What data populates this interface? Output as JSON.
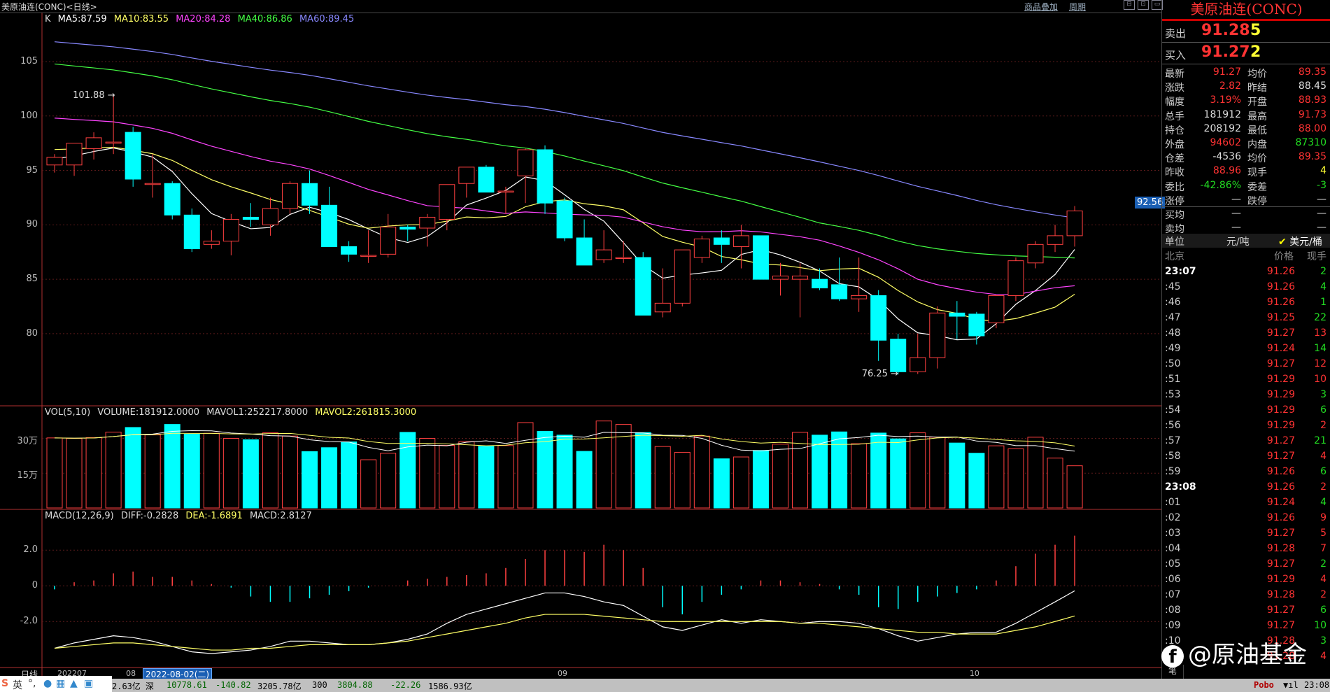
{
  "window": {
    "title": "美原油连(CONC)<日线>",
    "links": [
      "商品叠加",
      "周期"
    ]
  },
  "main_legend": {
    "k": "K",
    "ma": [
      {
        "label": "MA5:87.59",
        "color": "#ffffff"
      },
      {
        "label": "MA10:83.55",
        "color": "#ffff66"
      },
      {
        "label": "MA20:84.28",
        "color": "#ff44ff"
      },
      {
        "label": "MA40:86.86",
        "color": "#44ff44"
      },
      {
        "label": "MA60:89.45",
        "color": "#8888ff"
      }
    ]
  },
  "vol_legend": {
    "name": "VOL(5,10)",
    "volume": "VOLUME:181912.0000",
    "mavol1": "MAVOL1:252217.8000",
    "mavol2": "MAVOL2:261815.3000"
  },
  "macd_legend": {
    "name": "MACD(12,26,9)",
    "diff": "DIFF:-0.2828",
    "dea": "DEA:-1.6891",
    "macd": "MACD:2.8127"
  },
  "axes": {
    "price_ticks": [
      "105",
      "100",
      "95",
      "90",
      "85",
      "80"
    ],
    "vol_ticks": [
      "30万",
      "15万"
    ],
    "macd_ticks": [
      "2.0",
      "0",
      "-2.0"
    ],
    "date_labels": [
      "202207",
      "08",
      "09",
      "10"
    ],
    "cursor_date": "2022-08-02(二)",
    "period_tab": "日线"
  },
  "annotations": {
    "high": "101.88",
    "low": "76.25",
    "current_price_tag": "92.56"
  },
  "chart_data": {
    "type": "candlestick",
    "ohlc": [
      [
        95.5,
        96.5,
        94.8,
        96.2
      ],
      [
        95.5,
        97.5,
        94.5,
        97.5
      ],
      [
        97.0,
        98.5,
        96.0,
        98.0
      ],
      [
        97.5,
        101.88,
        96.5,
        97.6
      ],
      [
        98.5,
        99.0,
        93.5,
        94.2
      ],
      [
        93.8,
        96.5,
        92.5,
        93.8
      ],
      [
        93.8,
        94.0,
        90.5,
        90.9
      ],
      [
        90.9,
        91.5,
        87.5,
        87.8
      ],
      [
        88.2,
        89.5,
        87.8,
        88.5
      ],
      [
        88.5,
        91.0,
        87.2,
        90.5
      ],
      [
        90.7,
        92.0,
        89.8,
        90.5
      ],
      [
        90.0,
        92.5,
        89.0,
        91.5
      ],
      [
        91.5,
        94.0,
        91.0,
        93.8
      ],
      [
        93.8,
        95.0,
        91.0,
        91.8
      ],
      [
        91.8,
        93.5,
        88.0,
        88.0
      ],
      [
        88.0,
        88.5,
        86.6,
        87.3
      ],
      [
        87.2,
        89.5,
        86.5,
        87.2
      ],
      [
        87.3,
        91.0,
        87.0,
        89.8
      ],
      [
        89.8,
        90.0,
        88.5,
        89.6
      ],
      [
        89.7,
        91.0,
        88.0,
        90.7
      ],
      [
        90.5,
        93.5,
        89.5,
        93.7
      ],
      [
        93.8,
        95.0,
        92.5,
        95.3
      ],
      [
        95.3,
        95.5,
        93.0,
        93.0
      ],
      [
        93.0,
        93.5,
        91.0,
        93.1
      ],
      [
        94.5,
        97.0,
        92.0,
        96.9
      ],
      [
        96.9,
        97.3,
        91.0,
        92.0
      ],
      [
        92.2,
        92.5,
        88.5,
        88.8
      ],
      [
        88.8,
        90.5,
        86.3,
        86.3
      ],
      [
        86.8,
        89.5,
        86.5,
        87.7
      ],
      [
        87.0,
        88.5,
        86.5,
        87.0
      ],
      [
        87.0,
        87.5,
        81.8,
        81.7
      ],
      [
        82.0,
        86.0,
        81.5,
        82.8
      ],
      [
        82.8,
        87.0,
        82.5,
        87.7
      ],
      [
        87.0,
        89.0,
        86.5,
        88.7
      ],
      [
        88.8,
        89.5,
        86.5,
        88.2
      ],
      [
        88.0,
        90.0,
        86.0,
        89.0
      ],
      [
        89.0,
        89.0,
        85.0,
        85.0
      ],
      [
        85.0,
        86.5,
        83.5,
        85.3
      ],
      [
        85.0,
        86.5,
        81.5,
        85.3
      ],
      [
        85.0,
        86.0,
        84.0,
        84.2
      ],
      [
        84.5,
        87.0,
        83.0,
        83.2
      ],
      [
        83.2,
        87.0,
        82.0,
        83.5
      ],
      [
        83.5,
        84.0,
        77.5,
        79.4
      ],
      [
        79.5,
        80.0,
        76.25,
        76.5
      ],
      [
        76.5,
        80.0,
        76.3,
        77.8
      ],
      [
        77.8,
        82.5,
        76.8,
        81.9
      ],
      [
        81.9,
        83.0,
        79.5,
        81.6
      ],
      [
        81.8,
        82.0,
        79.0,
        79.8
      ],
      [
        81.0,
        83.5,
        80.5,
        83.5
      ],
      [
        83.5,
        87.0,
        83.0,
        86.7
      ],
      [
        86.5,
        88.5,
        86.0,
        88.2
      ],
      [
        88.2,
        90.0,
        87.5,
        89.0
      ],
      [
        89.0,
        91.73,
        88.0,
        91.28
      ]
    ],
    "volume": [
      302000,
      300000,
      303000,
      327000,
      347000,
      315000,
      360000,
      318000,
      322000,
      300000,
      294000,
      324000,
      310000,
      243000,
      260000,
      285000,
      208000,
      236000,
      326000,
      300000,
      270000,
      286000,
      266000,
      269000,
      368000,
      330000,
      314000,
      244000,
      375000,
      360000,
      325000,
      265000,
      240000,
      310000,
      212000,
      220000,
      248000,
      275000,
      326000,
      314000,
      328000,
      277000,
      323000,
      298000,
      324000,
      305000,
      280000,
      236000,
      268000,
      255000,
      305000,
      215000,
      181912
    ],
    "volume_ylim": [
      0,
      380000
    ],
    "price_ylim": [
      73.5,
      109.5
    ],
    "macd_hist": [
      -0.2,
      0.2,
      0.3,
      0.7,
      0.8,
      0.5,
      0.5,
      0.3,
      0.1,
      -0.1,
      -0.6,
      -0.9,
      -0.9,
      -0.7,
      -0.5,
      -0.3,
      -0.1,
      0.0,
      0.3,
      0.4,
      0.5,
      0.6,
      0.7,
      1.0,
      1.5,
      2.0,
      2.0,
      1.9,
      2.3,
      2.0,
      1.0,
      -1.2,
      -1.6,
      -0.9,
      -0.5,
      -0.2,
      0.3,
      0.3,
      0.2,
      0.1,
      -0.2,
      -0.5,
      -1.2,
      -1.3,
      -0.9,
      -0.6,
      -0.4,
      -0.2,
      0.3,
      1.1,
      1.8,
      2.3,
      2.81
    ],
    "diff": [
      -3.5,
      -3.2,
      -3.0,
      -2.8,
      -2.9,
      -3.1,
      -3.4,
      -3.7,
      -3.8,
      -3.7,
      -3.6,
      -3.4,
      -3.1,
      -3.1,
      -3.2,
      -3.3,
      -3.3,
      -3.2,
      -3.0,
      -2.7,
      -2.1,
      -1.6,
      -1.3,
      -1.0,
      -0.7,
      -0.4,
      -0.4,
      -0.6,
      -0.9,
      -1.1,
      -1.7,
      -2.3,
      -2.5,
      -2.2,
      -1.9,
      -2.1,
      -1.9,
      -2.0,
      -2.1,
      -2.0,
      -2.0,
      -2.1,
      -2.4,
      -2.8,
      -3.1,
      -2.9,
      -2.7,
      -2.6,
      -2.6,
      -2.1,
      -1.5,
      -0.9,
      -0.28
    ],
    "dea": [
      -3.5,
      -3.4,
      -3.3,
      -3.2,
      -3.2,
      -3.3,
      -3.4,
      -3.5,
      -3.6,
      -3.6,
      -3.5,
      -3.5,
      -3.4,
      -3.3,
      -3.3,
      -3.3,
      -3.3,
      -3.2,
      -3.1,
      -2.9,
      -2.7,
      -2.5,
      -2.3,
      -2.1,
      -1.8,
      -1.6,
      -1.6,
      -1.6,
      -1.7,
      -1.8,
      -1.9,
      -2.0,
      -2.0,
      -2.0,
      -2.0,
      -2.0,
      -2.0,
      -2.0,
      -2.1,
      -2.1,
      -2.2,
      -2.3,
      -2.4,
      -2.5,
      -2.6,
      -2.6,
      -2.7,
      -2.7,
      -2.7,
      -2.5,
      -2.3,
      -2.0,
      -1.69
    ],
    "macd_ylim": [
      -4.5,
      3.5
    ]
  },
  "panel": {
    "title": "美原油连(CONC)",
    "sell": {
      "label": "卖出",
      "price": "91.28",
      "qty": "5"
    },
    "buy": {
      "label": "买入",
      "price": "91.27",
      "qty": "2"
    },
    "rows": [
      [
        "最新",
        "91.27",
        "red",
        "均价",
        "89.35",
        "red"
      ],
      [
        "涨跌",
        "2.82",
        "red",
        "昨结",
        "88.45",
        "white"
      ],
      [
        "幅度",
        "3.19%",
        "red",
        "开盘",
        "88.93",
        "red"
      ],
      [
        "总手",
        "181912",
        "white",
        "最高",
        "91.73",
        "red"
      ],
      [
        "持仓",
        "208192",
        "white",
        "最低",
        "88.00",
        "red"
      ],
      [
        "外盘",
        "94602",
        "red",
        "内盘",
        "87310",
        "green"
      ],
      [
        "仓差",
        "-4536",
        "white",
        "均价",
        "89.35",
        "red"
      ],
      [
        "昨收",
        "88.96",
        "red",
        "现手",
        "4",
        "yellow"
      ],
      [
        "委比",
        "-42.86%",
        "green",
        "委差",
        "-3",
        "green"
      ],
      [
        "涨停",
        "—",
        "white",
        "跌停",
        "—",
        "white"
      ],
      [
        "买均",
        "—",
        "white",
        "",
        "—",
        "white"
      ],
      [
        "卖均",
        "—",
        "white",
        "",
        "—",
        "white"
      ]
    ],
    "unit": {
      "label": "单位",
      "opt1": "元/吨",
      "opt2": "美元/桶"
    },
    "tick_header": {
      "time": "北京",
      "price": "价格",
      "vol": "现手"
    },
    "ticks": [
      [
        "23:07",
        "91.26",
        "2",
        "green"
      ],
      [
        ":45",
        "91.26",
        "4",
        "green"
      ],
      [
        ":46",
        "91.26",
        "1",
        "green"
      ],
      [
        ":47",
        "91.25",
        "22",
        "green"
      ],
      [
        ":48",
        "91.27",
        "13",
        "red"
      ],
      [
        ":49",
        "91.24",
        "14",
        "green"
      ],
      [
        ":50",
        "91.27",
        "12",
        "red"
      ],
      [
        ":51",
        "91.29",
        "10",
        "red"
      ],
      [
        ":53",
        "91.29",
        "3",
        "green"
      ],
      [
        ":54",
        "91.29",
        "6",
        "green"
      ],
      [
        ":56",
        "91.29",
        "2",
        "red"
      ],
      [
        ":57",
        "91.27",
        "21",
        "green"
      ],
      [
        ":58",
        "91.27",
        "4",
        "red"
      ],
      [
        ":59",
        "91.26",
        "6",
        "green"
      ],
      [
        "23:08",
        "91.26",
        "2",
        "red"
      ],
      [
        ":01",
        "91.24",
        "4",
        "green"
      ],
      [
        ":02",
        "91.26",
        "9",
        "red"
      ],
      [
        ":03",
        "91.27",
        "5",
        "red"
      ],
      [
        ":04",
        "91.28",
        "7",
        "red"
      ],
      [
        ":05",
        "91.27",
        "2",
        "green"
      ],
      [
        ":06",
        "91.29",
        "4",
        "red"
      ],
      [
        ":07",
        "91.28",
        "2",
        "red"
      ],
      [
        ":08",
        "91.27",
        "6",
        "green"
      ],
      [
        ":09",
        "91.27",
        "10",
        "green"
      ],
      [
        ":10",
        "91.28",
        "3",
        "green"
      ],
      [
        ":11",
        "91.28",
        "4",
        "red"
      ]
    ],
    "side_tab": "笔"
  },
  "watermark": {
    "icon": "f",
    "text": "@原油基金"
  },
  "statusbar": {
    "ime": "英",
    "items": [
      {
        "text": "2.63亿",
        "cls": ""
      },
      {
        "text": "深",
        "cls": ""
      },
      {
        "text": "10778.61",
        "cls": "sb-g"
      },
      {
        "text": "-140.82",
        "cls": "sb-g"
      },
      {
        "text": "3205.78亿",
        "cls": ""
      },
      {
        "text": "300",
        "cls": ""
      },
      {
        "text": "3804.88",
        "cls": "sb-g"
      },
      {
        "text": "-22.26",
        "cls": "sb-g"
      },
      {
        "text": "1586.93亿",
        "cls": ""
      }
    ],
    "brand": "Pobo",
    "clock": "23:08"
  }
}
